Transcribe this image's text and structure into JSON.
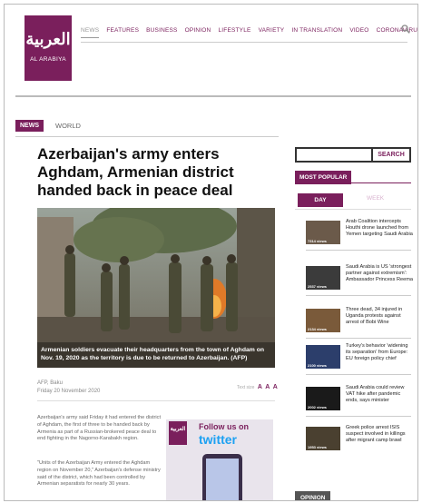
{
  "site": {
    "logo_arabic": "العربية",
    "logo_english": "AL ARABIYA"
  },
  "nav": {
    "items": [
      "NEWS",
      "FEATURES",
      "BUSINESS",
      "OPINION",
      "LIFESTYLE",
      "VARIETY",
      "IN TRANSLATION",
      "VIDEO",
      "CORONAVIRUS"
    ],
    "active": "NEWS",
    "search_icon": "search-icon"
  },
  "breadcrumb": {
    "section": "NEWS",
    "subsection": "WORLD"
  },
  "article": {
    "headline": "Azerbaijan's army enters Aghdam, Armenian district handed back in peace deal",
    "caption": "Armenian soldiers evacuate their headquarters from the town of Aghdam on Nov. 19, 2020 as the territory is due to be returned to Azerbaijan. (AFP)",
    "author": "AFP, Baku",
    "date": "Friday 20 November 2020",
    "text_size_label": "Text size",
    "text_size_glyphs": [
      "A",
      "A",
      "A"
    ],
    "paragraphs": [
      "Azerbaijan's army said Friday it had entered the district of Aghdam, the first of three to be handed back by Armenia as part of a Russian-brokered peace deal to end fighting in the Nagorno-Karabakh region.",
      "\"Units of the Azerbaijan Army entered the Aghdam region on November 20,\" Azerbaijan's defense ministry said of the district, which had been controlled by Armenian separatists for nearly 30 years."
    ]
  },
  "twitter_promo": {
    "logo_text": "العربية",
    "logo_sub": "AL ARABIYA ENGLISH",
    "follow": "Follow us on",
    "brand": "twitter"
  },
  "sidebar": {
    "search_button": "SEARCH",
    "search_placeholder": "",
    "most_popular": "MOST POPULAR",
    "tabs": [
      "DAY",
      "WEEK"
    ],
    "active_tab": "DAY",
    "items": [
      {
        "title": "Arab Coalition intercepts Houthi drone launched from Yemen targeting Saudi Arabia",
        "views": "7314 views",
        "thumb_color": "#6b5a4a"
      },
      {
        "title": "Saudi Arabia is US 'strongest partner against extremism': Ambassador Princess Reema",
        "views": "2537 views",
        "thumb_color": "#3b3b3b"
      },
      {
        "title": "Three dead, 34 injured in Uganda protests against arrest of Bobi Wine",
        "views": "2134 views",
        "thumb_color": "#7a5a3a"
      },
      {
        "title": "Turkey's behavior 'widening its separation' from Europe: EU foreign policy chief",
        "views": "2100 views",
        "thumb_color": "#2c3e6b"
      },
      {
        "title": "Saudi Arabia could review VAT hike after pandemic ends, says minister",
        "views": "2002 views",
        "thumb_color": "#1a1a1a"
      },
      {
        "title": "Greek police arrest ISIS suspect involved in killings after migrant camp brawl",
        "views": "1953 views",
        "thumb_color": "#4a4030"
      }
    ],
    "opinion": "OPINION"
  }
}
